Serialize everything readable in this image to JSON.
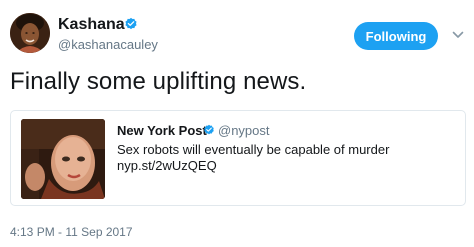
{
  "tweet": {
    "author": {
      "name": "Kashana",
      "handle": "@kashanacauley",
      "verified": true
    },
    "follow_button": "Following",
    "text": "Finally some uplifting news.",
    "timestamp": "4:13 PM - 11 Sep 2017"
  },
  "quoted_tweet": {
    "name": "New York Post",
    "handle": "@nypost",
    "verified": true,
    "text": "Sex robots will eventually be capable of murder nyp.st/2wUzQEQ"
  },
  "colors": {
    "accent": "#1da1f2",
    "secondary_text": "#657786",
    "border": "#e1e8ed"
  },
  "icons": {
    "verified": "verified-badge-icon",
    "menu": "chevron-down-icon"
  }
}
